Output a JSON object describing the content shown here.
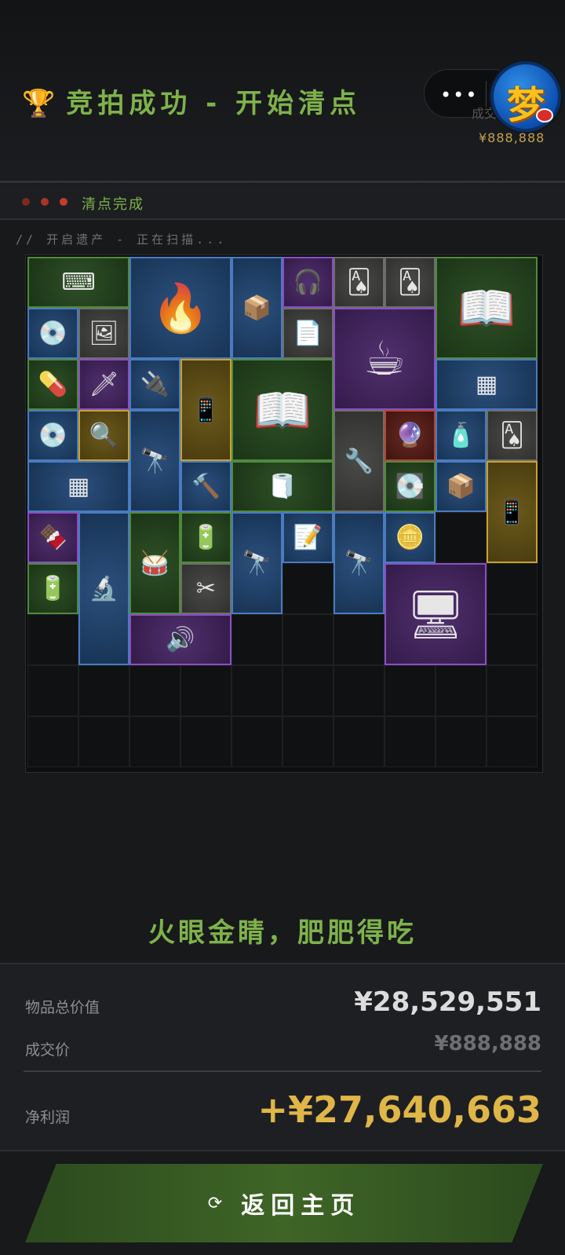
{
  "header": {
    "title": "竞拍成功 - 开始清点",
    "trophy_icon": "🏆",
    "capsule_dots": "•••",
    "capsule_partial": "成交",
    "logo_glyph": "梦",
    "price_tag": "¥888,888"
  },
  "status": {
    "label": "清点完成",
    "dot_colors": [
      "#7a2a22",
      "#a8352a",
      "#c43b2d"
    ]
  },
  "scan_text": "// 开启遗产 - 正在扫描...",
  "inventory": {
    "grid_cols": 10,
    "grid_rows": 10,
    "items": [
      {
        "name": "keyboard",
        "rarity": "green",
        "icon": "⌨"
      },
      {
        "name": "camping-stove",
        "rarity": "blue",
        "icon": "🔥"
      },
      {
        "name": "ammo-box",
        "rarity": "blue",
        "icon": "📦"
      },
      {
        "name": "headset",
        "rarity": "purple",
        "icon": "🎧"
      },
      {
        "name": "playing-card",
        "rarity": "gray",
        "icon": "🂡"
      },
      {
        "name": "playing-card",
        "rarity": "gray",
        "icon": "🂡"
      },
      {
        "name": "magazine",
        "rarity": "green",
        "icon": "📖"
      },
      {
        "name": "cd-disc",
        "rarity": "blue",
        "icon": "💿"
      },
      {
        "name": "photo-card",
        "rarity": "gray",
        "icon": "🖼"
      },
      {
        "name": "coffee-machine",
        "rarity": "purple",
        "icon": "☕"
      },
      {
        "name": "paper",
        "rarity": "gray",
        "icon": "📄"
      },
      {
        "name": "medicine-bottle",
        "rarity": "green",
        "icon": "💊"
      },
      {
        "name": "arrowhead",
        "rarity": "purple",
        "icon": "🗡"
      },
      {
        "name": "usb-drive",
        "rarity": "blue",
        "icon": "🔌"
      },
      {
        "name": "satellite-phone",
        "rarity": "gold",
        "icon": "📱"
      },
      {
        "name": "magazine",
        "rarity": "green",
        "icon": "📖"
      },
      {
        "name": "mat",
        "rarity": "blue",
        "icon": "▦"
      },
      {
        "name": "cd-disc",
        "rarity": "blue",
        "icon": "💿"
      },
      {
        "name": "lens",
        "rarity": "gold",
        "icon": "🔍"
      },
      {
        "name": "spyglass",
        "rarity": "blue",
        "icon": "🔭"
      },
      {
        "name": "tool",
        "rarity": "gray",
        "icon": "🔧"
      },
      {
        "name": "orb",
        "rarity": "red",
        "icon": "🔮"
      },
      {
        "name": "bottle",
        "rarity": "blue",
        "icon": "🧴"
      },
      {
        "name": "playing-card",
        "rarity": "gray",
        "icon": "🂡"
      },
      {
        "name": "mat",
        "rarity": "blue",
        "icon": "▦"
      },
      {
        "name": "hammer",
        "rarity": "blue",
        "icon": "🔨"
      },
      {
        "name": "cloth",
        "rarity": "green",
        "icon": "🧻"
      },
      {
        "name": "hard-drive",
        "rarity": "green",
        "icon": "💽"
      },
      {
        "name": "ammo-box",
        "rarity": "blue",
        "icon": "📦"
      },
      {
        "name": "satellite-phone",
        "rarity": "gold",
        "icon": "📱"
      },
      {
        "name": "energy-bar",
        "rarity": "purple",
        "icon": "🍫"
      },
      {
        "name": "microscope",
        "rarity": "blue",
        "icon": "🔬"
      },
      {
        "name": "drum",
        "rarity": "green",
        "icon": "🥁"
      },
      {
        "name": "battery",
        "rarity": "green",
        "icon": "🔋"
      },
      {
        "name": "spyglass",
        "rarity": "blue",
        "icon": "🔭"
      },
      {
        "name": "notepad",
        "rarity": "blue",
        "icon": "📝"
      },
      {
        "name": "spyglass",
        "rarity": "blue",
        "icon": "🔭"
      },
      {
        "name": "coin",
        "rarity": "blue",
        "icon": "🪙"
      },
      {
        "name": "batteries",
        "rarity": "green",
        "icon": "🔋"
      },
      {
        "name": "scissors",
        "rarity": "gray",
        "icon": "✂"
      },
      {
        "name": "motherboard",
        "rarity": "purple",
        "icon": "🖥"
      },
      {
        "name": "speaker",
        "rarity": "purple",
        "icon": "🔊"
      }
    ]
  },
  "slogan": "火眼金睛，肥肥得吃",
  "summary": {
    "total_label": "物品总价值",
    "total_value": "¥28,529,551",
    "deal_label": "成交价",
    "deal_value": "¥888,888",
    "net_label": "净利润",
    "net_value": "+¥27,640,663"
  },
  "home_button": {
    "icon": "⟳",
    "label": "返回主页"
  },
  "colors": {
    "accent_green": "#7fb24a",
    "gold": "#e0b647"
  }
}
